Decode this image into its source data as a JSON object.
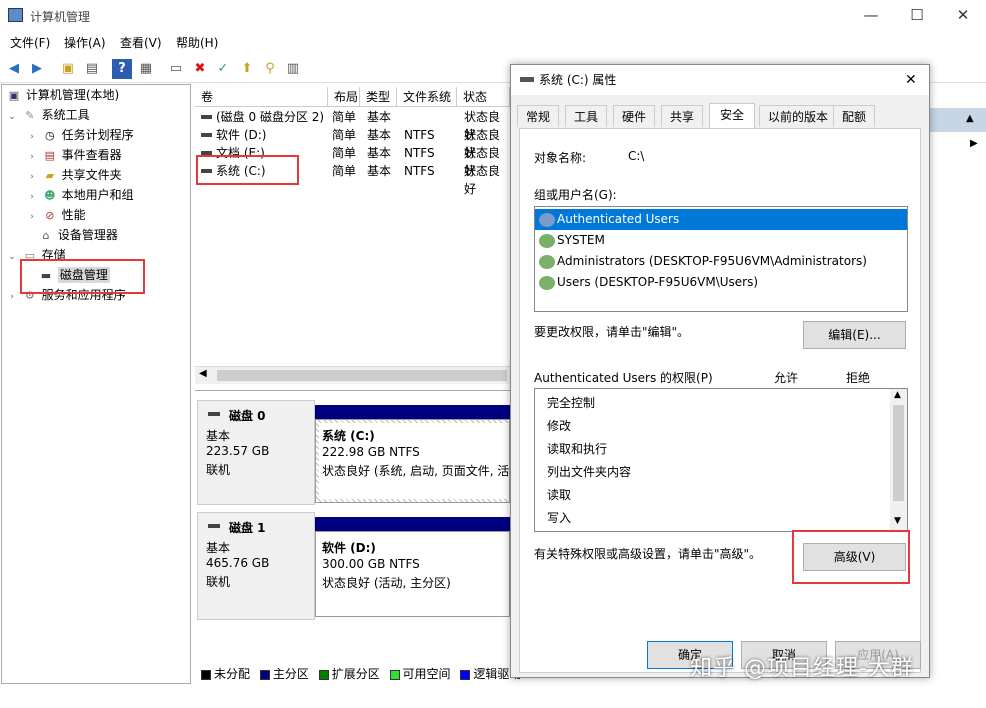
{
  "window": {
    "title": "计算机管理",
    "minimize": "—",
    "maximize": "☐",
    "close": "✕"
  },
  "menu": [
    "文件(F)",
    "操作(A)",
    "查看(V)",
    "帮助(H)"
  ],
  "tree": {
    "root": "计算机管理(本地)",
    "system_tools": "系统工具",
    "task_scheduler": "任务计划程序",
    "event_viewer": "事件查看器",
    "shared_folders": "共享文件夹",
    "local_users": "本地用户和组",
    "performance": "性能",
    "device_manager": "设备管理器",
    "storage": "存储",
    "disk_management": "磁盘管理",
    "services_apps": "服务和应用程序"
  },
  "volume_list": {
    "headers": [
      "卷",
      "布局",
      "类型",
      "文件系统",
      "状态"
    ],
    "rows": [
      [
        "(磁盘 0 磁盘分区 2)",
        "简单",
        "基本",
        "",
        "状态良好"
      ],
      [
        "软件 (D:)",
        "简单",
        "基本",
        "NTFS",
        "状态良好"
      ],
      [
        "文档 (E:)",
        "简单",
        "基本",
        "NTFS",
        "状态良好"
      ],
      [
        "系统 (C:)",
        "简单",
        "基本",
        "NTFS",
        "状态良好"
      ]
    ]
  },
  "disks": [
    {
      "name": "磁盘 0",
      "type": "基本",
      "size": "223.57 GB",
      "status": "联机",
      "partition_name": "系统 (C:)",
      "partition_size": "222.98 GB NTFS",
      "partition_status": "状态良好 (系统, 启动, 页面文件, 活动"
    },
    {
      "name": "磁盘 1",
      "type": "基本",
      "size": "465.76 GB",
      "status": "联机",
      "partition_name": "软件 (D:)",
      "partition_size": "300.00 GB NTFS",
      "partition_status": "状态良好 (活动, 主分区)"
    }
  ],
  "legend": [
    "未分配",
    "主分区",
    "扩展分区",
    "可用空间",
    "逻辑驱动"
  ],
  "legend_colors": [
    "#000000",
    "#000080",
    "#008000",
    "#33dd33",
    "#0000ff"
  ],
  "dialog": {
    "title": "系统 (C:) 属性",
    "close": "✕",
    "tabs": [
      "常规",
      "工具",
      "硬件",
      "共享",
      "安全",
      "以前的版本",
      "配额"
    ],
    "object_label": "对象名称:",
    "object_value": "C:\\",
    "group_label": "组或用户名(G):",
    "users": [
      "Authenticated Users",
      "SYSTEM",
      "Administrators (DESKTOP-F95U6VM\\Administrators)",
      "Users (DESKTOP-F95U6VM\\Users)"
    ],
    "change_hint": "要更改权限，请单击\"编辑\"。",
    "edit_button": "编辑(E)...",
    "perm_label": "Authenticated Users 的权限(P)",
    "allow": "允许",
    "deny": "拒绝",
    "permissions": [
      "完全控制",
      "修改",
      "读取和执行",
      "列出文件夹内容",
      "读取",
      "写入"
    ],
    "advanced_hint": "有关特殊权限或高级设置，请单击\"高级\"。",
    "advanced_button": "高级(V)",
    "ok": "确定",
    "cancel": "取消",
    "apply": "应用(A)"
  },
  "watermark": "知乎 @项目经理-大群",
  "colors": {
    "selection": "#0078d7",
    "highlight_box": "#e23a3a",
    "disk_bar": "#000080"
  }
}
